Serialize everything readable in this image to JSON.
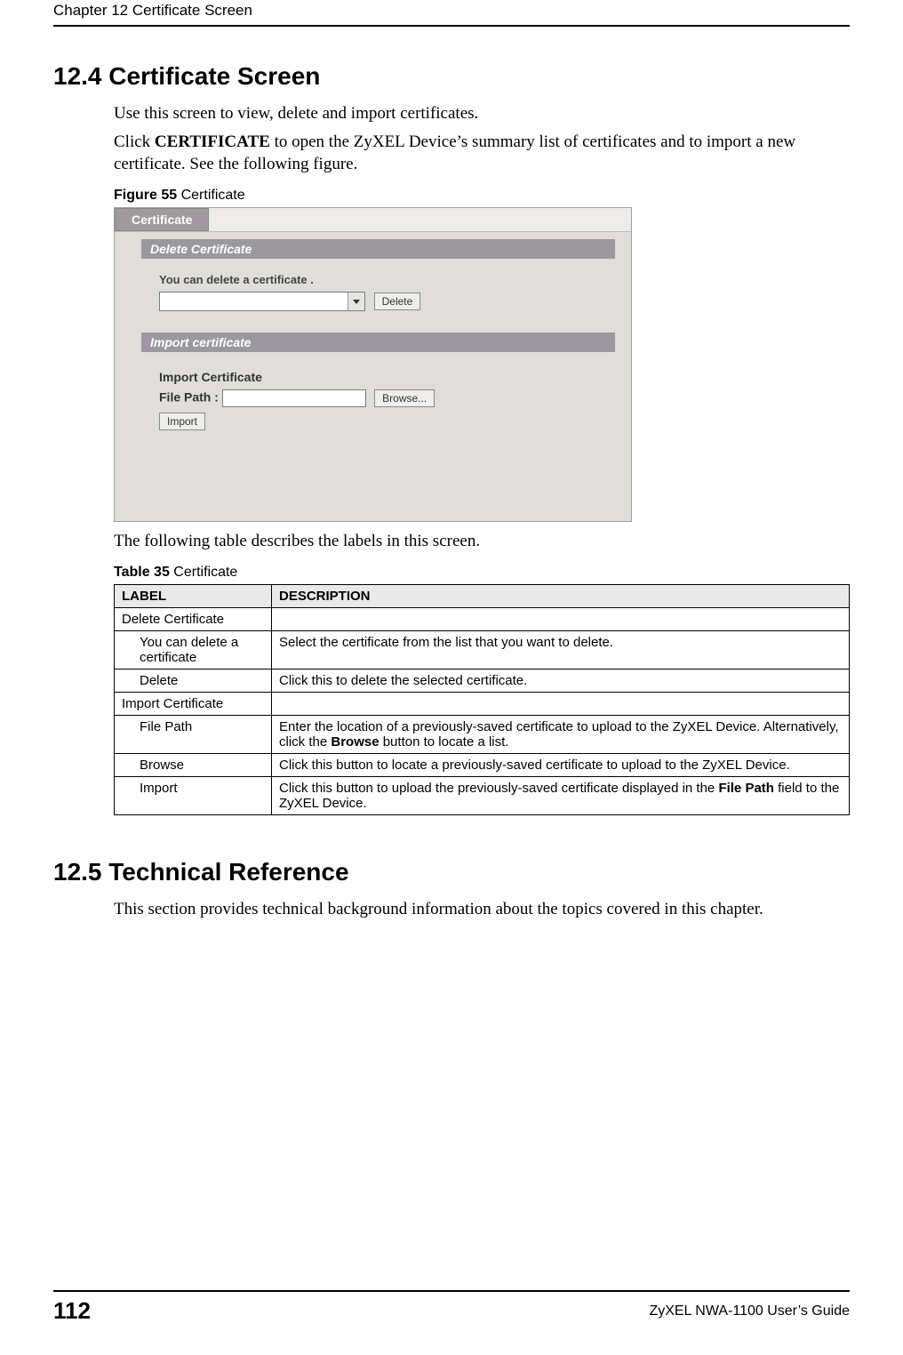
{
  "header": {
    "chapter_line": "Chapter 12 Certificate Screen"
  },
  "sec1": {
    "heading": "12.4  Certificate Screen",
    "p1": "Use this screen to view, delete and import certificates.",
    "p2_a": "Click ",
    "p2_bold": "CERTIFICATE",
    "p2_b": " to open the ZyXEL Device’s summary list of certificates and to import a new certificate. See the following figure."
  },
  "figure": {
    "label": "Figure 55",
    "caption": "   Certificate",
    "tab": "Certificate",
    "delete_bar": "Delete Certificate",
    "delete_text": "You can delete a certificate .",
    "delete_btn": "Delete",
    "import_bar": "Import certificate",
    "import_header": "Import Certificate",
    "filepath_label": "File Path :",
    "browse_btn": "Browse...",
    "import_btn": "Import"
  },
  "after_fig": "The following table describes the labels in this screen.",
  "table": {
    "label": "Table 35",
    "caption": "   Certificate",
    "th_label": "LABEL",
    "th_desc": "DESCRIPTION",
    "rows": [
      {
        "label": "Delete Certificate",
        "indent": false,
        "desc": ""
      },
      {
        "label": "You can delete a certificate",
        "indent": true,
        "desc": "Select the certificate from the list that you want to delete."
      },
      {
        "label": "Delete",
        "indent": true,
        "desc": "Click this to delete the selected certificate."
      },
      {
        "label": "Import Certificate",
        "indent": false,
        "desc": ""
      },
      {
        "label": "File Path",
        "indent": true,
        "desc_a": "Enter the location of a previously-saved certificate to upload to the ZyXEL Device. Alternatively, click the ",
        "desc_bold": "Browse",
        "desc_b": " button to locate a list."
      },
      {
        "label": "Browse",
        "indent": true,
        "desc": "Click this button to locate a previously-saved certificate to upload to the ZyXEL Device."
      },
      {
        "label": "Import",
        "indent": true,
        "desc_a": "Click this button to upload the previously-saved certificate displayed in the ",
        "desc_bold": "File Path",
        "desc_b": " field to the ZyXEL Device."
      }
    ]
  },
  "sec2": {
    "heading": "12.5  Technical Reference",
    "p1": "This section provides technical background information about the topics covered in this chapter."
  },
  "footer": {
    "page": "112",
    "guide": "ZyXEL NWA-1100 User’s Guide"
  }
}
